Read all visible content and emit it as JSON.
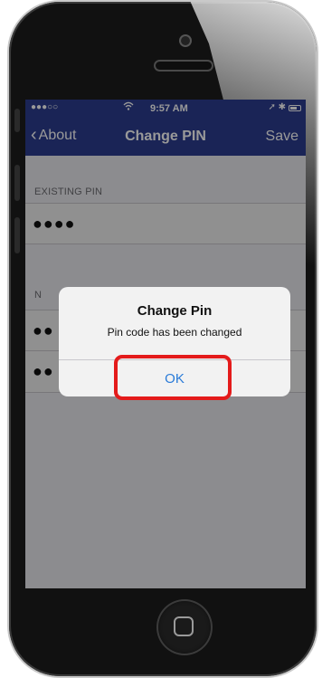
{
  "status_bar": {
    "signal": "●●●○○",
    "wifi_icon": "wifi-icon",
    "time": "9:57 AM",
    "right_indicators": "➚ ✱",
    "battery_icon": "battery-icon"
  },
  "nav": {
    "back_label": "About",
    "title": "Change PIN",
    "save_label": "Save"
  },
  "form": {
    "existing_label": "EXISTING PIN",
    "existing_value": "●●●●",
    "new_label_partial": "N",
    "new_pin_value": "●●",
    "confirm_pin_value": "●●"
  },
  "alert": {
    "title": "Change Pin",
    "message": "Pin code has been changed",
    "ok_label": "OK"
  },
  "colors": {
    "nav_bar": "#2c3d8f",
    "alert_button": "#2a7bd8",
    "highlight": "#e41b1b"
  }
}
